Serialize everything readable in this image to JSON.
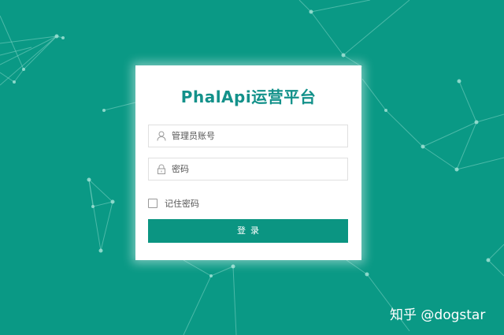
{
  "login": {
    "title": "PhalApi运营平台",
    "username_placeholder": "管理员账号",
    "password_placeholder": "密码",
    "remember_label": "记住密码",
    "remember_checked": false,
    "submit_label": "登录"
  },
  "watermark": {
    "text": "知乎 @dogstar"
  },
  "colors": {
    "background": "#0a9985",
    "accent": "#13918a",
    "button": "#0b9582",
    "card": "#ffffff"
  },
  "icons": {
    "username": "user-icon",
    "password": "lock-icon"
  }
}
